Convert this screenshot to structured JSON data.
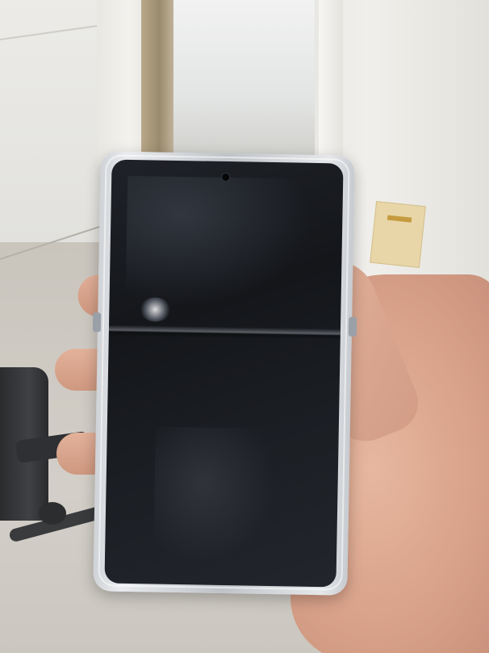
{
  "scene": {
    "subject": "foldable-phone",
    "screen_state": "off",
    "colors": {
      "screen": "#15171b",
      "phone_frame": "#c9cdd2",
      "skin": "#d9a28a",
      "wall": "#e8e7e3",
      "floor": "#cbc7c0",
      "chair": "#2f3033"
    }
  }
}
